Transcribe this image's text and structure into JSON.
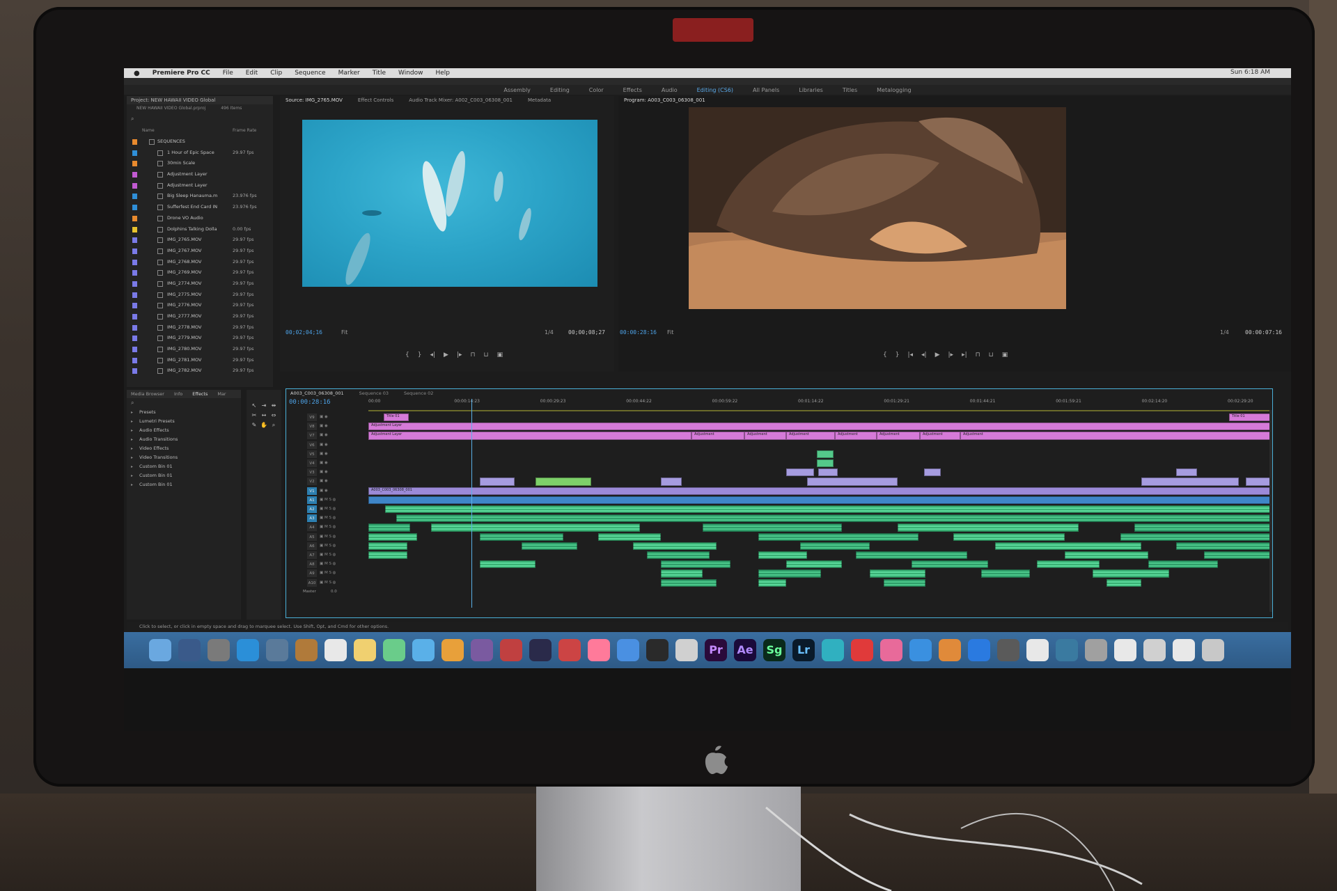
{
  "menubar": {
    "app": "Premiere Pro CC",
    "items": [
      "File",
      "Edit",
      "Clip",
      "Sequence",
      "Marker",
      "Title",
      "Window",
      "Help"
    ],
    "clock": "Sun 6:18 AM"
  },
  "workspaces": {
    "items": [
      "Assembly",
      "Editing",
      "Color",
      "Effects",
      "Audio",
      "Editing (CS6)",
      "All Panels",
      "Libraries",
      "Titles",
      "Metalogging"
    ],
    "active_index": 5
  },
  "project": {
    "tab": "Project: NEW HAWAII VIDEO Global",
    "subtitle": "NEW HAWAII VIDEO Global.prproj",
    "items_count": "496 Items",
    "col_name": "Name",
    "col_rate": "Frame Rate",
    "rows": [
      {
        "name": "SEQUENCES",
        "rate": "",
        "level": 0,
        "color": "#e88a2e"
      },
      {
        "name": "1 Hour of Epic Space",
        "rate": "29.97 fps",
        "level": 1,
        "color": "#2f8fd8"
      },
      {
        "name": "30min Scale",
        "rate": "",
        "level": 1,
        "color": "#e88a2e"
      },
      {
        "name": "Adjustment Layer",
        "rate": "",
        "level": 1,
        "color": "#c25ad2"
      },
      {
        "name": "Adjustment Layer",
        "rate": "",
        "level": 1,
        "color": "#c25ad2"
      },
      {
        "name": "Big Sleep Hanauma.m",
        "rate": "23.976 fps",
        "level": 1,
        "color": "#2f8fd8"
      },
      {
        "name": "Sufferfest End Card IN",
        "rate": "23.976 fps",
        "level": 1,
        "color": "#2f8fd8"
      },
      {
        "name": "Drone VO Audio",
        "rate": "",
        "level": 1,
        "color": "#e88a2e"
      },
      {
        "name": "Dolphins Talking Dolla",
        "rate": "0.00 fps",
        "level": 1,
        "color": "#e8c22e"
      },
      {
        "name": "IMG_2765.MOV",
        "rate": "29.97 fps",
        "level": 1,
        "color": "#7a7ae8"
      },
      {
        "name": "IMG_2767.MOV",
        "rate": "29.97 fps",
        "level": 1,
        "color": "#7a7ae8"
      },
      {
        "name": "IMG_2768.MOV",
        "rate": "29.97 fps",
        "level": 1,
        "color": "#7a7ae8"
      },
      {
        "name": "IMG_2769.MOV",
        "rate": "29.97 fps",
        "level": 1,
        "color": "#7a7ae8"
      },
      {
        "name": "IMG_2774.MOV",
        "rate": "29.97 fps",
        "level": 1,
        "color": "#7a7ae8"
      },
      {
        "name": "IMG_2775.MOV",
        "rate": "29.97 fps",
        "level": 1,
        "color": "#7a7ae8"
      },
      {
        "name": "IMG_2776.MOV",
        "rate": "29.97 fps",
        "level": 1,
        "color": "#7a7ae8"
      },
      {
        "name": "IMG_2777.MOV",
        "rate": "29.97 fps",
        "level": 1,
        "color": "#7a7ae8"
      },
      {
        "name": "IMG_2778.MOV",
        "rate": "29.97 fps",
        "level": 1,
        "color": "#7a7ae8"
      },
      {
        "name": "IMG_2779.MOV",
        "rate": "29.97 fps",
        "level": 1,
        "color": "#7a7ae8"
      },
      {
        "name": "IMG_2780.MOV",
        "rate": "29.97 fps",
        "level": 1,
        "color": "#7a7ae8"
      },
      {
        "name": "IMG_2781.MOV",
        "rate": "29.97 fps",
        "level": 1,
        "color": "#7a7ae8"
      },
      {
        "name": "IMG_2782.MOV",
        "rate": "29.97 fps",
        "level": 1,
        "color": "#7a7ae8"
      }
    ]
  },
  "source": {
    "tabs": [
      "Source: IMG_2765.MOV",
      "Effect Controls",
      "Audio Track Mixer: A002_C003_06308_001",
      "Metadata"
    ],
    "timecode_in": "00;02;04;16",
    "timecode_out": "00;00;08;27",
    "zoom": "Fit",
    "scale": "1/4"
  },
  "program": {
    "tab": "Program: A003_C003_06308_001",
    "timecode_in": "00:00:28:16",
    "timecode_out": "00:00:07:16",
    "zoom": "Fit",
    "scale": "1/4"
  },
  "effects": {
    "tabs": [
      "Media Browser",
      "Info",
      "Effects",
      "Mar"
    ],
    "active_index": 2,
    "items": [
      "Presets",
      "Lumetri Presets",
      "Audio Effects",
      "Audio Transitions",
      "Video Effects",
      "Video Transitions",
      "Custom Bin 01",
      "Custom Bin 01",
      "Custom Bin 01"
    ]
  },
  "timeline": {
    "tabs": [
      "A003_C003_06308_001",
      "Sequence 03",
      "Sequence 02"
    ],
    "timecode": "00:00:28:16",
    "ruler": [
      "00:00",
      "00:00:14:23",
      "00:00:29:23",
      "00:00:44:22",
      "00:00:59:22",
      "00:01:14:22",
      "00:01:29:21",
      "00:01:44:21",
      "00:01:59:21",
      "00:02:14:20",
      "00:02:29:20"
    ],
    "video_tracks": [
      "V9",
      "V8",
      "V7",
      "V6",
      "V5",
      "V4",
      "V3",
      "V2",
      "V1"
    ],
    "audio_tracks": [
      "A1",
      "A2",
      "A3",
      "A4",
      "A5",
      "A6",
      "A7",
      "A8",
      "A9",
      "A10"
    ],
    "master": "Master",
    "master_level": "0.0",
    "clip_labels": {
      "title": "Title 01",
      "adj": "Adjustment Layer",
      "adj_short": "Adjustment",
      "v1": "A003_C003_06308_001"
    }
  },
  "status": "Click to select, or click in empty space and drag to marquee select. Use Shift, Opt, and Cmd for other options.",
  "dock": {
    "apps": [
      "Pr",
      "Ae",
      "Sg",
      "Lr"
    ]
  }
}
